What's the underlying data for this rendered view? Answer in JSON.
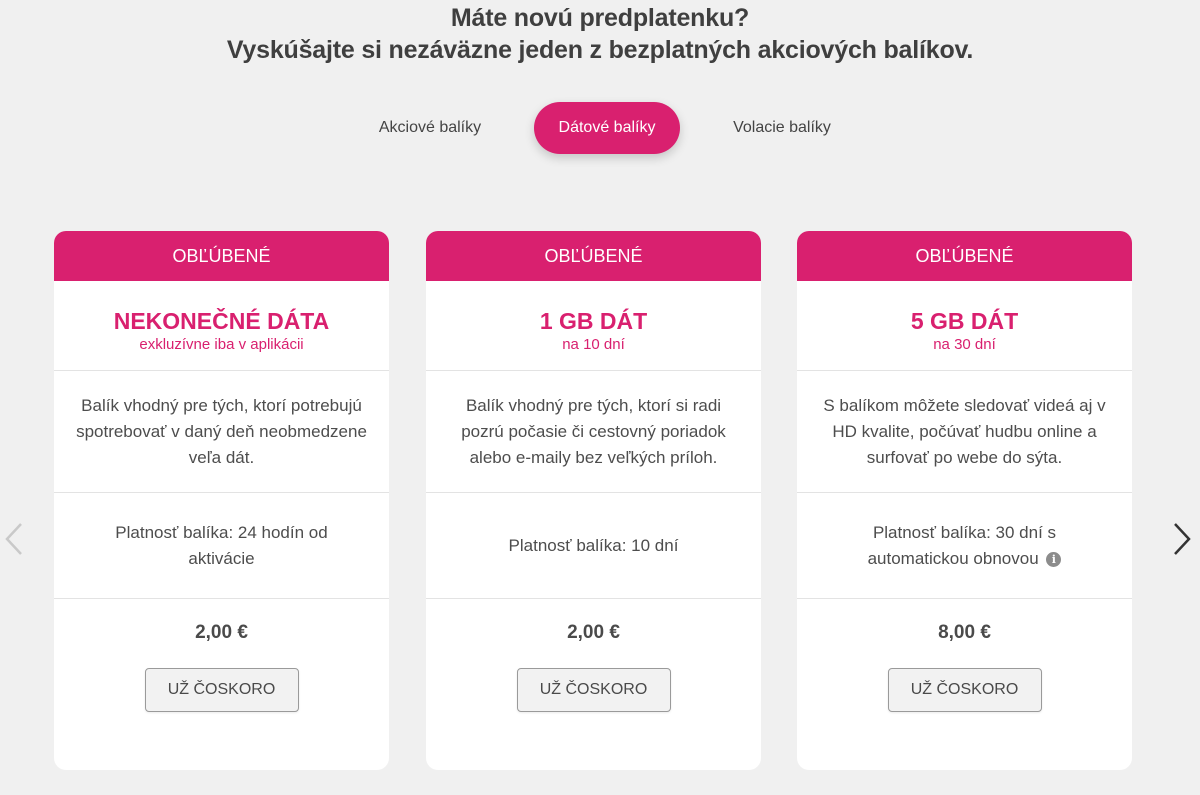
{
  "header": {
    "line1": "Máte novú predplatenku?",
    "line2": "Vyskúšajte si nezáväzne jeden z bezplatných akciových balíkov."
  },
  "tabs": [
    {
      "label": "Akciové balíky",
      "active": false
    },
    {
      "label": "Dátové balíky",
      "active": true
    },
    {
      "label": "Volacie balíky",
      "active": false
    }
  ],
  "cards": [
    {
      "badge": "OBĽÚBENÉ",
      "title": "NEKONEČNÉ DÁTA",
      "subtitle": "exkluzívne iba v aplikácii",
      "description": "Balík vhodný pre tých, ktorí potrebujú spotrebovať v daný deň neobmedzene veľa dát.",
      "validity": "Platnosť balíka: 24 hodín od aktivácie",
      "price": "2,00 €",
      "button": "UŽ ČOSKORO"
    },
    {
      "badge": "OBĽÚBENÉ",
      "title": "1 GB DÁT",
      "subtitle": "na 10 dní",
      "description": "Balík vhodný pre tých, ktorí si radi pozrú počasie či cestovný poriadok alebo e-maily bez veľkých príloh.",
      "validity": "Platnosť balíka: 10 dní",
      "price": "2,00 €",
      "button": "UŽ ČOSKORO"
    },
    {
      "badge": "OBĽÚBENÉ",
      "title": "5 GB DÁT",
      "subtitle": "na 30 dní",
      "description": "S balíkom môžete sledovať videá aj v HD kvalite, počúvať hudbu online a surfovať po webe do sýta.",
      "validity": "Platnosť balíka: 30 dní s automatickou obnovou",
      "price": "8,00 €",
      "button": "UŽ ČOSKORO",
      "info_icon": "info-icon"
    }
  ],
  "carousel": {
    "prev_icon": "chevron-left-icon",
    "next_icon": "chevron-right-icon"
  },
  "colors": {
    "accent": "#d9206f",
    "background": "#f0f0f0",
    "card": "#ffffff"
  }
}
